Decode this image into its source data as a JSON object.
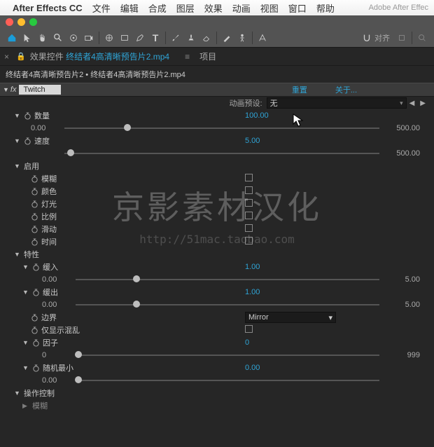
{
  "mac_menu": {
    "app": "After Effects CC",
    "items": [
      "文件",
      "编辑",
      "合成",
      "图层",
      "效果",
      "动画",
      "视图",
      "窗口",
      "帮助"
    ],
    "brand": "Adobe After Effec"
  },
  "toolbar": {
    "align_label": "对齐"
  },
  "tabs": {
    "tab1_prefix": "效果控件",
    "tab1_file": "终结者4高清晰预告片2.mp4",
    "tab2": "项目"
  },
  "breadcrumb": "终结者4高清晰预告片2 • 终结者4高清晰预告片2.mp4",
  "effect": {
    "name": "Twitch",
    "reset": "重置",
    "about": "关于..."
  },
  "preset": {
    "label": "动画预设:",
    "value": "无"
  },
  "props": {
    "amount": {
      "label": "数量",
      "value": "100.00",
      "min": "0.00",
      "max": "500.00",
      "pos": 20
    },
    "speed": {
      "label": "速度",
      "value": "5.00",
      "max": "500.00",
      "pos": 2
    },
    "enable": {
      "label": "启用"
    },
    "blur": "模糊",
    "color": "颜色",
    "light": "灯光",
    "scale": "比例",
    "slide": "滑动",
    "time": "时间",
    "behavior": {
      "label": "特性"
    },
    "easein": {
      "label": "缓入",
      "value": "1.00",
      "min": "0.00",
      "max": "5.00",
      "pos": 20
    },
    "easeout": {
      "label": "缓出",
      "value": "1.00",
      "min": "0.00",
      "max": "5.00",
      "pos": 20
    },
    "border": {
      "label": "边界",
      "value": "Mirror"
    },
    "onlychaos": "仅显示混乱",
    "seed": {
      "label": "因子",
      "value": "0",
      "min": "0",
      "max": "999",
      "pos": 1
    },
    "randmin": {
      "label": "随机最小",
      "value": "0.00",
      "min": "0.00"
    },
    "opcontrol": "操作控制",
    "blur2": "模糊"
  },
  "watermark": {
    "big": "京影素材汉化",
    "small": "http://51mac.taobao.com"
  }
}
